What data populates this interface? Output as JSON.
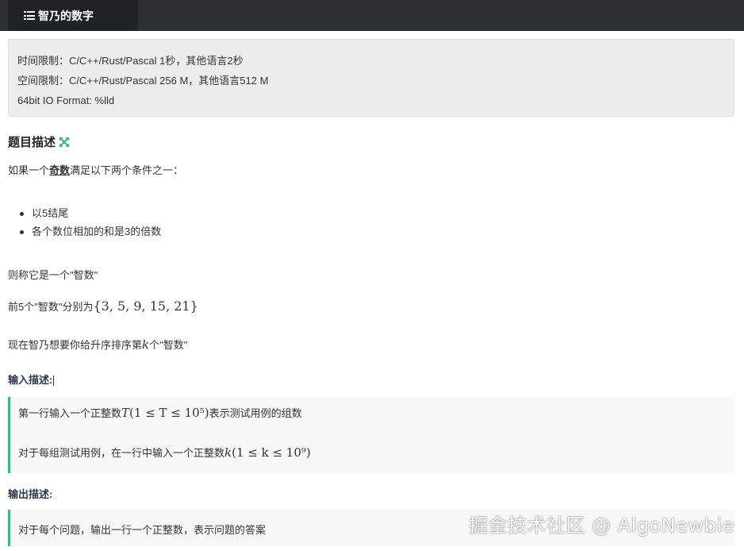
{
  "header": {
    "tab_title": "智乃的数字"
  },
  "limits": {
    "time": "时间限制：C/C++/Rust/Pascal 1秒，其他语言2秒",
    "space": "空间限制：C/C++/Rust/Pascal 256 M，其他语言512 M",
    "format": "64bit IO Format: %lld"
  },
  "description": {
    "title": "题目描述",
    "intro_before": "如果一个",
    "intro_keyword": "奇数",
    "intro_after": "满足以下两个条件之一：",
    "conditions": [
      "以5结尾",
      "各个数位相加的和是3的倍数"
    ],
    "called": "则称它是一个\"智数\"",
    "first5_prefix": "前5个\"智数\"分别为",
    "first5_set": "{3, 5, 9, 15, 21}",
    "ask_prefix": "现在智乃想要你给升序排序第",
    "ask_var": "k",
    "ask_suffix": "个\"智数\""
  },
  "input": {
    "title": "输入描述:",
    "line1_prefix": "第一行输入一个正整数",
    "line1_math_var": "T",
    "line1_math_range": "(1 ≤ T ≤ 10⁵)",
    "line1_suffix": "表示测试用例的组数",
    "line2_prefix": "对于每组测试用例，在一行中输入一个正整数",
    "line2_math_var": "k",
    "line2_math_range": "(1 ≤ k ≤ 10⁹)"
  },
  "output": {
    "title": "输出描述:",
    "line1": "对于每个问题，输出一行一个正整数，表示问题的答案"
  },
  "watermark": "掘金技术社区 @ AlgoNewbie",
  "colors": {
    "topbar": "#2c3035",
    "active_tab": "#1f2226",
    "quote_border": "#42b983",
    "expand_icon": "#3bb56b"
  }
}
